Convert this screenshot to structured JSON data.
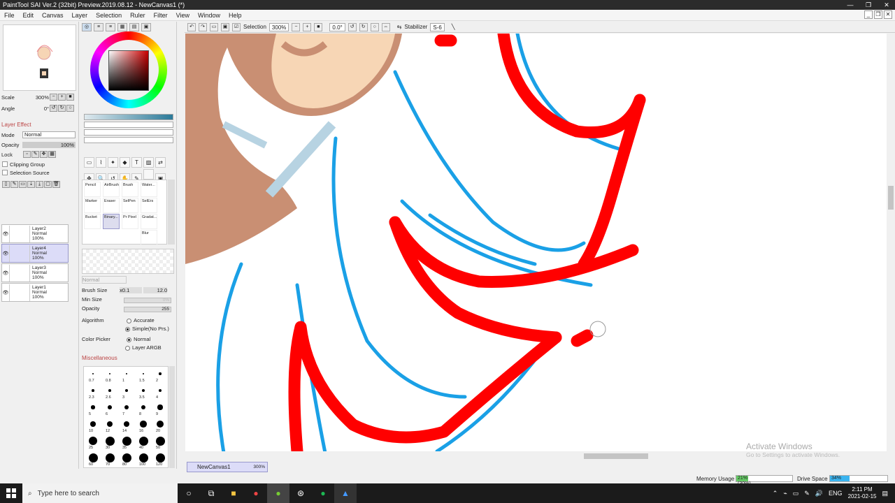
{
  "window": {
    "title": "PaintTool SAI Ver.2 (32bit) Preview.2019.08.12 - NewCanvas1 (*)",
    "controls": [
      "—",
      "❐",
      "✕"
    ]
  },
  "menu": [
    "File",
    "Edit",
    "Canvas",
    "Layer",
    "Selection",
    "Ruler",
    "Filter",
    "View",
    "Window",
    "Help"
  ],
  "navigator": {
    "scale_label": "Scale",
    "scale_value": "300%",
    "angle_label": "Angle",
    "angle_value": "0°"
  },
  "layer_panel": {
    "effect_title": "Layer Effect",
    "mode_label": "Mode",
    "mode_value": "Normal",
    "opacity_label": "Opacity",
    "opacity_value": "100%",
    "lock_label": "Lock",
    "clipping_label": "Clipping Group",
    "selection_source_label": "Selection Source",
    "layers": [
      {
        "name": "Layer2",
        "mode": "Normal",
        "opacity": "100%",
        "selected": false
      },
      {
        "name": "Layer4",
        "mode": "Normal",
        "opacity": "100%",
        "selected": true
      },
      {
        "name": "Layer3",
        "mode": "Normal",
        "opacity": "100%",
        "selected": false
      },
      {
        "name": "Layer1",
        "mode": "Normal",
        "opacity": "100%",
        "selected": false
      }
    ]
  },
  "brushes": {
    "row1": [
      "Pencil",
      "AirBrush",
      "Brush",
      "Water..."
    ],
    "row2": [
      "Marker",
      "Eraser",
      "SelPen",
      "SelErs"
    ],
    "row3": [
      "Bucket",
      "Binary...",
      "Pr Pixel",
      "Gradat..."
    ],
    "row4": [
      "",
      "",
      "",
      "Blur"
    ]
  },
  "brush_props": {
    "mode": "Normal",
    "brush_size_label": "Brush Size",
    "brush_size_mult": "x0.1",
    "brush_size_value": "12.0",
    "min_size_label": "Min Size",
    "min_size_value": "0%",
    "opacity_label": "Opacity",
    "opacity_value": "255",
    "algorithm_label": "Algorithm",
    "algorithm_opt1": "Accurate",
    "algorithm_opt2": "Simple(No Prs.)",
    "color_picker_label": "Color Picker",
    "color_picker_opt1": "Normal",
    "color_picker_opt2": "Layer ARGB",
    "misc_label": "Miscellaneous"
  },
  "dot_sizes": [
    "0.7",
    "0.8",
    "1",
    "1.5",
    "2",
    "2.3",
    "2.6",
    "3",
    "3.5",
    "4",
    "5",
    "6",
    "7",
    "8",
    "9",
    "10",
    "12",
    "14",
    "16",
    "20",
    "25",
    "30",
    "35",
    "40",
    "50",
    "60",
    "70",
    "80",
    "100",
    "120"
  ],
  "canvas_toolbar": {
    "selection_label": "Selection",
    "zoom": "300%",
    "angle": "0.0°",
    "stabilizer_label": "Stabilizer",
    "stabilizer_value": "S-6"
  },
  "doc_tab": {
    "name": "NewCanvas1",
    "zoom": "300%"
  },
  "watermark": {
    "line1": "Activate Windows",
    "line2": "Go to Settings to activate Windows."
  },
  "status": {
    "memory_label": "Memory Usage",
    "memory_value": "21% (30%)",
    "memory_fraction": 0.21,
    "drive_label": "Drive Space",
    "drive_value": "34%",
    "drive_fraction": 0.34
  },
  "taskbar": {
    "search_placeholder": "Type here to search",
    "lang": "ENG",
    "time": "2:11 PM",
    "date": "2021-02-15"
  },
  "colors": {
    "red_stroke": "#ff0000",
    "blue_stroke": "#1aa0e6",
    "skin": "#f6d5b5",
    "outline": "#c68d72"
  }
}
